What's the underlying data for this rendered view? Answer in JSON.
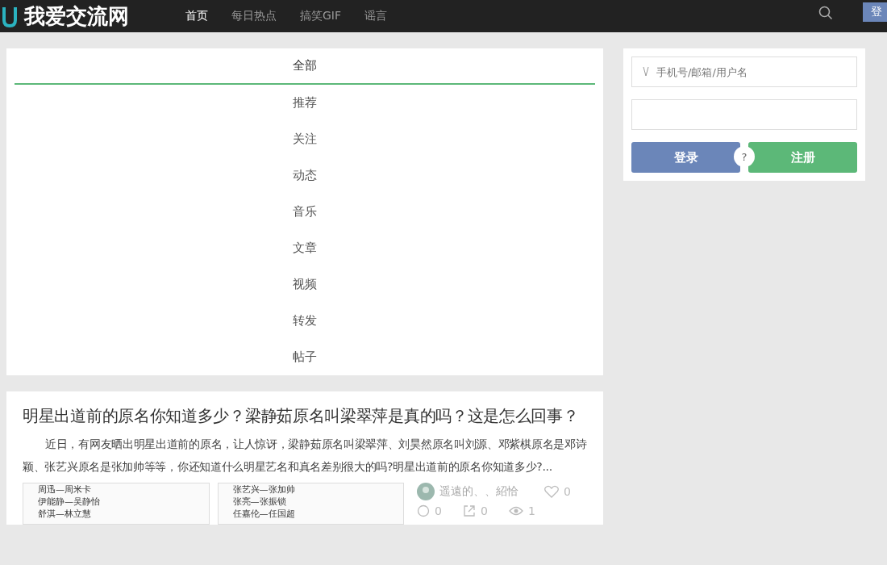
{
  "header": {
    "site_name": "我爱交流网",
    "nav": [
      {
        "label": "首页",
        "selected": true
      },
      {
        "label": "每日热点",
        "selected": false
      },
      {
        "label": "搞笑GIF",
        "selected": false
      },
      {
        "label": "谣言",
        "selected": false
      }
    ],
    "login_button": "登"
  },
  "categories": [
    {
      "label": "全部",
      "selected": true
    },
    {
      "label": "推荐",
      "selected": false
    },
    {
      "label": "关注",
      "selected": false
    },
    {
      "label": "动态",
      "selected": false
    },
    {
      "label": "音乐",
      "selected": false
    },
    {
      "label": "文章",
      "selected": false
    },
    {
      "label": "视频",
      "selected": false
    },
    {
      "label": "转发",
      "selected": false
    },
    {
      "label": "帖子",
      "selected": false
    }
  ],
  "login_form": {
    "username": {
      "placeholder": "手机号/邮箱/用户名"
    },
    "login": "登录",
    "help": "?",
    "register": "注册"
  },
  "article": {
    "title": "明星出道前的原名你知道多少？梁静茹原名叫梁翠萍是真的吗？这是怎么回事？",
    "summary": "近日，有网友晒出明星出道前的原名，让人惊讶，梁静茹原名叫梁翠萍、刘昊然原名叫刘源、邓紫棋原名是邓诗颖、张艺兴原名是张加帅等等，你还知道什么明星艺名和真名差别很大的吗?明星出道前的原名你知道多少?...",
    "images": [
      {
        "lines": [
          "周迅—周米卡",
          "伊能静—吴静怡",
          "舒淇—林立慧"
        ]
      },
      {
        "lines": [
          "张艺兴—张加帅",
          "张亮—张振锁",
          "任嘉伦—任国超"
        ]
      }
    ],
    "author": "遥遠的、、紹恰",
    "likes": "0",
    "comments": "0",
    "shares": "0",
    "views": "1"
  }
}
